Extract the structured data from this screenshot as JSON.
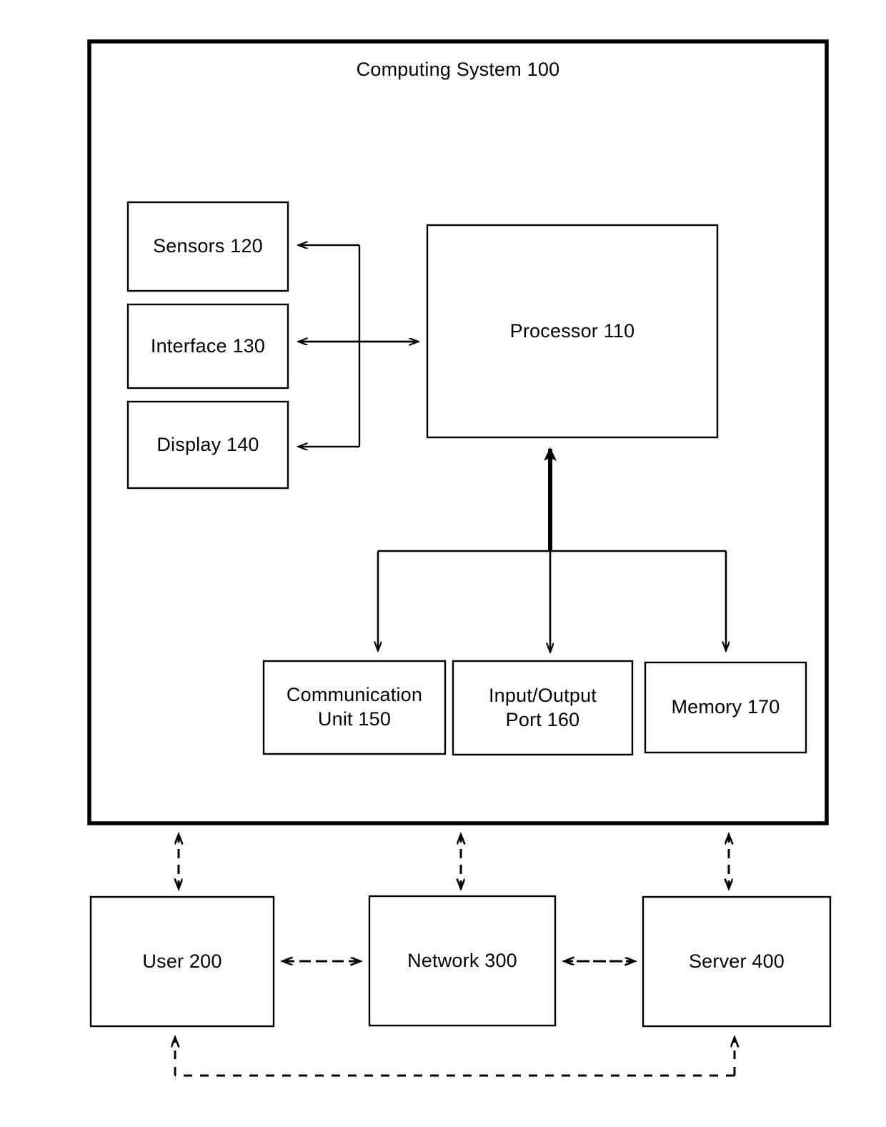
{
  "diagram": {
    "title": "Computing System 100",
    "type": "block-diagram",
    "background_color": "#ffffff",
    "line_color": "#000000",
    "blocks": {
      "system": {
        "label": "Computing System 100",
        "ref": "100"
      },
      "processor": {
        "label": "Processor 110",
        "ref": "110"
      },
      "sensors": {
        "label": "Sensors 120",
        "ref": "120"
      },
      "interface": {
        "label": "Interface 130",
        "ref": "130"
      },
      "display": {
        "label": "Display 140",
        "ref": "140"
      },
      "communication_unit": {
        "label": "Communication\nUnit 150",
        "ref": "150"
      },
      "io_port": {
        "label": "Input/Output\nPort 160",
        "ref": "160"
      },
      "memory": {
        "label": "Memory 170",
        "ref": "170"
      },
      "user": {
        "label": "User 200",
        "ref": "200"
      },
      "network": {
        "label": "Network 300",
        "ref": "300"
      },
      "server": {
        "label": "Server 400",
        "ref": "400"
      }
    },
    "connections": [
      {
        "from": "processor",
        "to": "sensors",
        "style": "solid",
        "arrows": "single"
      },
      {
        "from": "processor",
        "to": "interface",
        "style": "solid",
        "arrows": "double"
      },
      {
        "from": "processor",
        "to": "display",
        "style": "solid",
        "arrows": "single"
      },
      {
        "from": "processor",
        "to": "communication_unit",
        "style": "solid",
        "arrows": "single"
      },
      {
        "from": "processor",
        "to": "io_port",
        "style": "solid",
        "arrows": "double"
      },
      {
        "from": "processor",
        "to": "memory",
        "style": "solid",
        "arrows": "single"
      },
      {
        "from": "system",
        "to": "user",
        "style": "dashed",
        "arrows": "double"
      },
      {
        "from": "system",
        "to": "network",
        "style": "dashed",
        "arrows": "double"
      },
      {
        "from": "system",
        "to": "server",
        "style": "dashed",
        "arrows": "double"
      },
      {
        "from": "user",
        "to": "network",
        "style": "dashed",
        "arrows": "double"
      },
      {
        "from": "network",
        "to": "server",
        "style": "dashed",
        "arrows": "double"
      },
      {
        "from": "server",
        "to": "user",
        "style": "dashed",
        "arrows": "double"
      }
    ]
  }
}
